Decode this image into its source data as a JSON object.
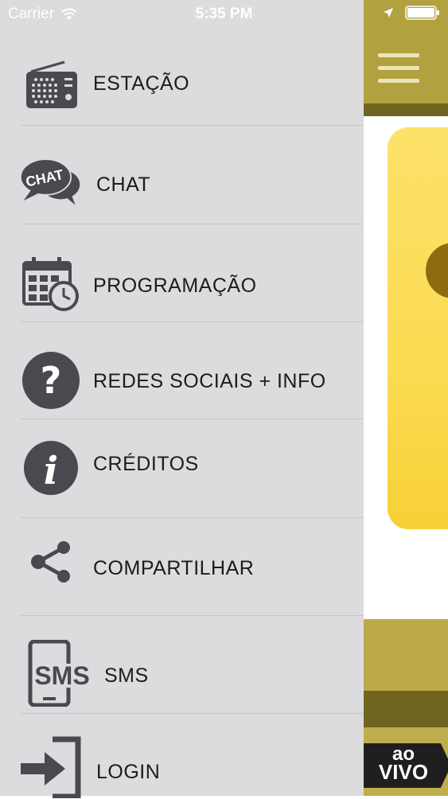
{
  "status_bar": {
    "carrier": "Carrier",
    "time": "5:35 PM"
  },
  "menu": {
    "items": [
      {
        "label": "ESTAÇÃO",
        "icon": "radio-icon"
      },
      {
        "label": "CHAT",
        "icon": "chat-bubbles-icon"
      },
      {
        "label": "PROGRAMAÇÃO",
        "icon": "calendar-clock-icon"
      },
      {
        "label": "REDES SOCIAIS + INFO",
        "icon": "question-circle-icon"
      },
      {
        "label": "CRÉDITOS",
        "icon": "info-circle-icon"
      },
      {
        "label": "COMPARTILHAR",
        "icon": "share-icon"
      },
      {
        "label": "SMS",
        "icon": "sms-phone-icon"
      },
      {
        "label": "LOGIN",
        "icon": "login-arrow-icon"
      }
    ]
  },
  "icons_text": {
    "chat": "CHAT",
    "sms": "SMS"
  },
  "live_badge": {
    "line1": "ao",
    "line2": "VIVO"
  },
  "colors": {
    "drawer_bg": "#dcdbdd",
    "icon": "#4a4950",
    "header": "#b2a13f",
    "card": "#fbdb52"
  }
}
